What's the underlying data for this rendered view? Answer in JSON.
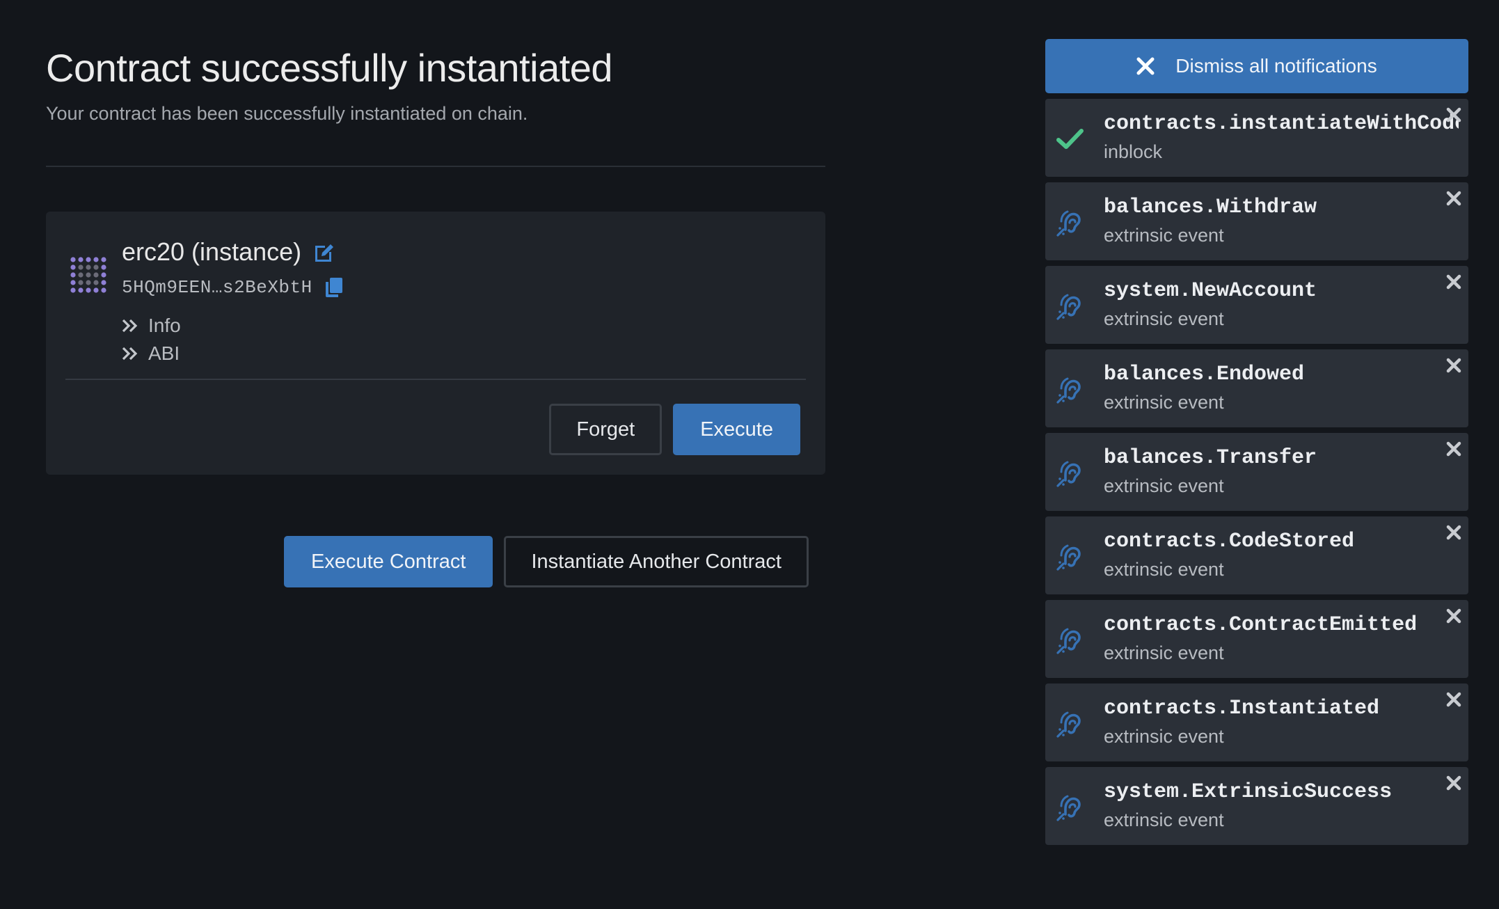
{
  "page": {
    "title": "Contract successfully instantiated",
    "subtitle": "Your contract has been successfully instantiated on chain."
  },
  "contract": {
    "name": "erc20 (instance)",
    "address": "5HQm9EEN…s2BeXbtH",
    "links": [
      {
        "label": "Info",
        "icon": "double-chevron-right-icon"
      },
      {
        "label": "ABI",
        "icon": "double-chevron-right-icon"
      }
    ],
    "forget_label": "Forget",
    "execute_label": "Execute"
  },
  "actions": {
    "execute_contract_label": "Execute Contract",
    "instantiate_another_label": "Instantiate Another Contract"
  },
  "notifications": {
    "dismiss_all_label": "Dismiss all notifications",
    "items": [
      {
        "title": "contracts.instantiateWithCode",
        "subtitle": "inblock",
        "icon": "check-icon"
      },
      {
        "title": "balances.Withdraw",
        "subtitle": "extrinsic event",
        "icon": "assistive-listening-icon"
      },
      {
        "title": "system.NewAccount",
        "subtitle": "extrinsic event",
        "icon": "assistive-listening-icon"
      },
      {
        "title": "balances.Endowed",
        "subtitle": "extrinsic event",
        "icon": "assistive-listening-icon"
      },
      {
        "title": "balances.Transfer",
        "subtitle": "extrinsic event",
        "icon": "assistive-listening-icon"
      },
      {
        "title": "contracts.CodeStored",
        "subtitle": "extrinsic event",
        "icon": "assistive-listening-icon"
      },
      {
        "title": "contracts.ContractEmitted",
        "subtitle": "extrinsic event",
        "icon": "assistive-listening-icon"
      },
      {
        "title": "contracts.Instantiated",
        "subtitle": "extrinsic event",
        "icon": "assistive-listening-icon"
      },
      {
        "title": "system.ExtrinsicSuccess",
        "subtitle": "extrinsic event",
        "icon": "assistive-listening-icon"
      }
    ]
  },
  "colors": {
    "background": "#13161b",
    "card": "#1f2329",
    "notification": "#2b3038",
    "accent": "#3772b5",
    "success": "#4ec38a",
    "identicon": "#8f80d6"
  }
}
